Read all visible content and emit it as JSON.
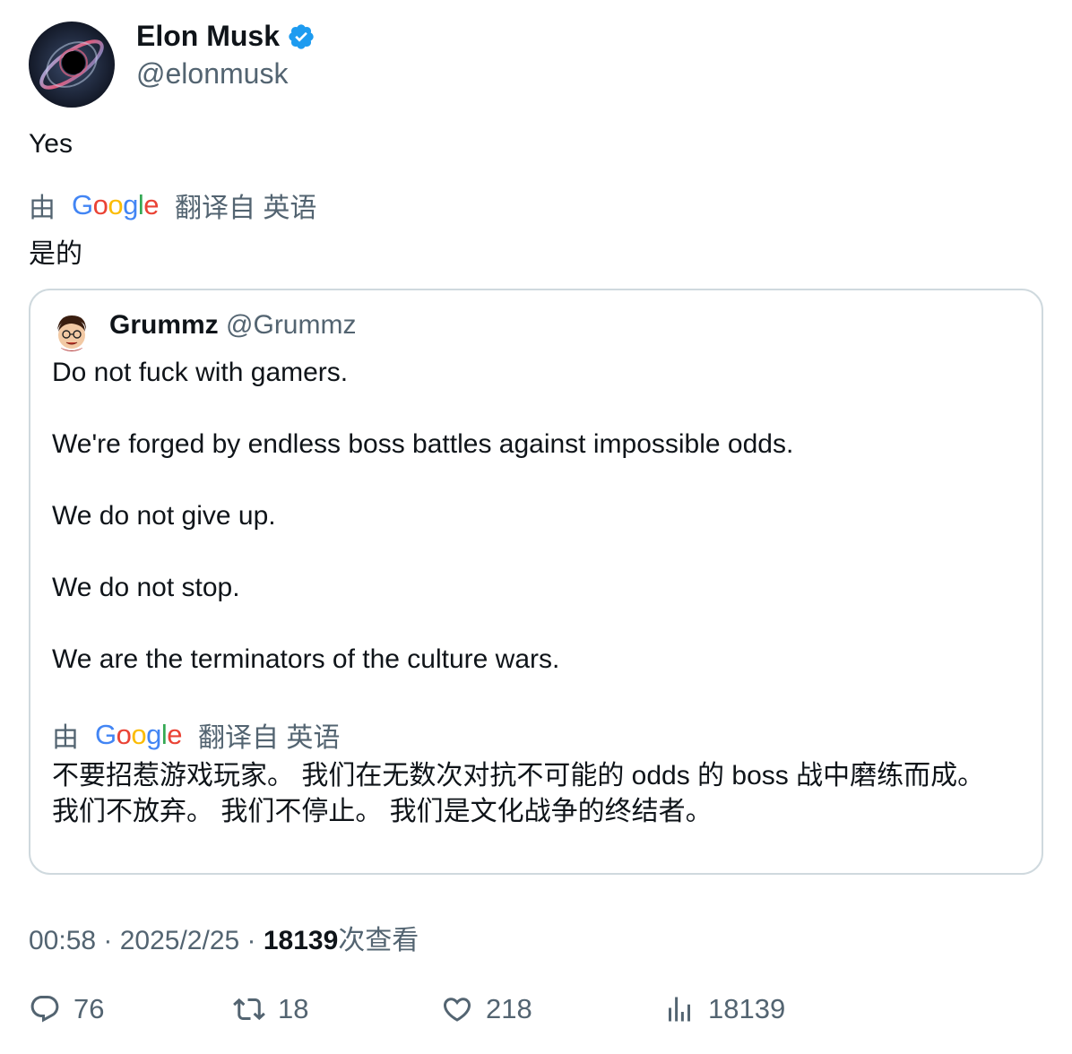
{
  "tweet": {
    "author_name": "Elon Musk",
    "author_handle": "@elonmusk",
    "text": "Yes",
    "translate_prefix": "由",
    "translate_suffix": "翻译自 英语",
    "translated_text": "是的",
    "meta_time": "00:58 · 2025/2/25 · ",
    "meta_views": "18139",
    "meta_views_suffix": "次查看"
  },
  "quote": {
    "author_name": "Grummz",
    "author_handle": "@Grummz",
    "lines": [
      "Do not fuck with gamers.",
      "We're forged by endless boss battles against impossible odds.",
      "We do not give up.",
      "We do not stop.",
      "We are the terminators of the culture wars."
    ],
    "translate_prefix": "由",
    "translate_suffix": "翻译自 英语",
    "translated_text": "不要招惹游戏玩家。 我们在无数次对抗不可能的 odds 的 boss 战中磨练而成。 我们不放弃。 我们不停止。 我们是文化战争的终结者。"
  },
  "actions": {
    "reply_count": "76",
    "retweet_count": "18",
    "like_count": "218",
    "views_count": "18139"
  },
  "icons": {
    "verified": "verified-badge-icon",
    "reply": "reply-icon",
    "retweet": "retweet-icon",
    "like": "heart-icon",
    "views": "views-chart-icon"
  },
  "colors": {
    "verified": "#1d9bf0",
    "secondary_text": "#536471",
    "border": "#cfd9de"
  }
}
